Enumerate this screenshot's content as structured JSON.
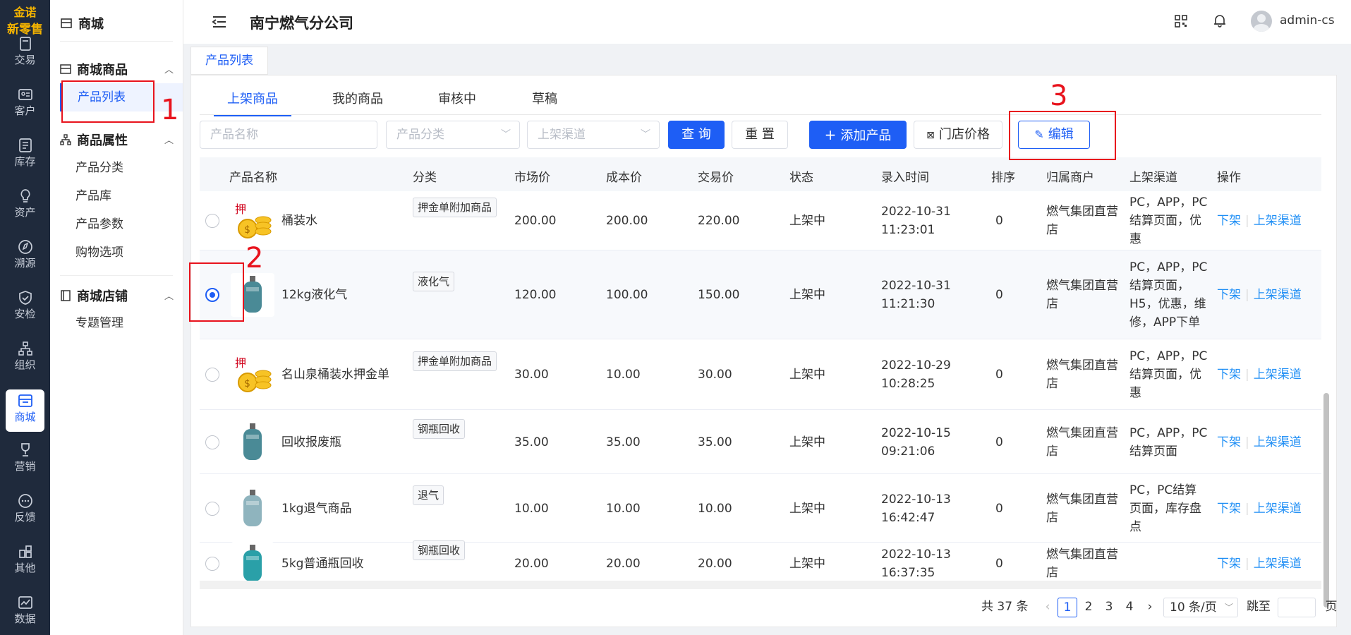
{
  "brand": {
    "line1": "金诺",
    "line2": "新零售"
  },
  "rail": [
    {
      "label": "交易",
      "icon": "trade-icon"
    },
    {
      "label": "客户",
      "icon": "customer-icon"
    },
    {
      "label": "库存",
      "icon": "inventory-icon"
    },
    {
      "label": "资产",
      "icon": "asset-icon"
    },
    {
      "label": "溯源",
      "icon": "trace-icon"
    },
    {
      "label": "安检",
      "icon": "safety-icon"
    },
    {
      "label": "组织",
      "icon": "org-icon"
    },
    {
      "label": "商城",
      "icon": "mall-icon",
      "active": true
    },
    {
      "label": "营销",
      "icon": "marketing-icon"
    },
    {
      "label": "反馈",
      "icon": "feedback-icon"
    },
    {
      "label": "其他",
      "icon": "other-icon"
    },
    {
      "label": "数据",
      "icon": "data-icon"
    }
  ],
  "menu": {
    "title": "商城",
    "groups": [
      {
        "title": "商城商品",
        "items": [
          "产品列表"
        ]
      },
      {
        "title": "商品属性",
        "items": [
          "产品分类",
          "产品库",
          "产品参数",
          "购物选项"
        ]
      },
      {
        "title": "商城店铺",
        "items": [
          "专题管理"
        ]
      }
    ]
  },
  "header": {
    "company": "南宁燃气分公司",
    "user": "admin-cs"
  },
  "page_tab": "产品列表",
  "subtabs": [
    "上架商品",
    "我的商品",
    "审核中",
    "草稿"
  ],
  "filters": {
    "name_placeholder": "产品名称",
    "category_placeholder": "产品分类",
    "channel_placeholder": "上架渠道",
    "query": "查 询",
    "reset": "重 置",
    "add": "添加产品",
    "store_price": "门店价格",
    "edit": "编辑"
  },
  "table": {
    "columns": [
      "产品名称",
      "分类",
      "市场价",
      "成本价",
      "交易价",
      "状态",
      "录入时间",
      "排序",
      "归属商户",
      "上架渠道",
      "操作"
    ],
    "rows": [
      {
        "name": "桶装水",
        "category": "押金单附加商品",
        "market": "200.00",
        "cost": "200.00",
        "trade": "220.00",
        "status": "上架中",
        "date": "2022-10-31",
        "time": "11:23:01",
        "sort": "0",
        "merchant1": "燃气集团直营",
        "merchant2": "店",
        "ch1": "PC，APP，PC",
        "ch2": "结算页面，优",
        "ch3": "惠",
        "ch4": "",
        "act1": "下架",
        "act2": "上架渠道",
        "selected": false
      },
      {
        "name": "12kg液化气",
        "category": "液化气",
        "market": "120.00",
        "cost": "100.00",
        "trade": "150.00",
        "status": "上架中",
        "date": "2022-10-31",
        "time": "11:21:30",
        "sort": "0",
        "merchant1": "燃气集团直营",
        "merchant2": "店",
        "ch1": "PC，APP，PC",
        "ch2": "结算页面，",
        "ch3": "H5，优惠，维",
        "ch4": "修，APP下单",
        "act1": "下架",
        "act2": "上架渠道",
        "selected": true
      },
      {
        "name": "名山泉桶装水押金单",
        "category": "押金单附加商品",
        "market": "30.00",
        "cost": "10.00",
        "trade": "30.00",
        "status": "上架中",
        "date": "2022-10-29",
        "time": "10:28:25",
        "sort": "0",
        "merchant1": "燃气集团直营",
        "merchant2": "店",
        "ch1": "PC，APP，PC",
        "ch2": "结算页面，优",
        "ch3": "惠",
        "ch4": "",
        "act1": "下架",
        "act2": "上架渠道",
        "selected": false
      },
      {
        "name": "回收报废瓶",
        "category": "钢瓶回收",
        "market": "35.00",
        "cost": "35.00",
        "trade": "35.00",
        "status": "上架中",
        "date": "2022-10-15",
        "time": "09:21:06",
        "sort": "0",
        "merchant1": "燃气集团直营",
        "merchant2": "店",
        "ch1": "PC，APP，PC",
        "ch2": "结算页面",
        "ch3": "",
        "ch4": "",
        "act1": "下架",
        "act2": "上架渠道",
        "selected": false
      },
      {
        "name": "1kg退气商品",
        "category": "退气",
        "market": "10.00",
        "cost": "10.00",
        "trade": "10.00",
        "status": "上架中",
        "date": "2022-10-13",
        "time": "16:42:47",
        "sort": "0",
        "merchant1": "燃气集团直营",
        "merchant2": "店",
        "ch1": "PC，PC结算",
        "ch2": "页面，库存盘",
        "ch3": "点",
        "ch4": "",
        "act1": "下架",
        "act2": "上架渠道",
        "selected": false
      },
      {
        "name": "5kg普通瓶回收",
        "category": "钢瓶回收",
        "market": "20.00",
        "cost": "20.00",
        "trade": "20.00",
        "status": "上架中",
        "date": "2022-10-13",
        "time": "16:37:35",
        "sort": "0",
        "merchant1": "燃气集团直营",
        "merchant2": "店",
        "ch1": "",
        "ch2": "",
        "ch3": "",
        "ch4": "",
        "act1": "下架",
        "act2": "上架渠道",
        "selected": false
      }
    ]
  },
  "pager": {
    "total": "共 37 条",
    "pages": [
      "1",
      "2",
      "3",
      "4"
    ],
    "current": "1",
    "size": "10 条/页",
    "jump_label": "跳至",
    "page_unit": "页"
  },
  "annotations": [
    "1",
    "2",
    "3"
  ],
  "colors": {
    "primary": "#1e5ef5",
    "rail_bg": "#1f2a3c",
    "annotation": "#e8131d"
  }
}
